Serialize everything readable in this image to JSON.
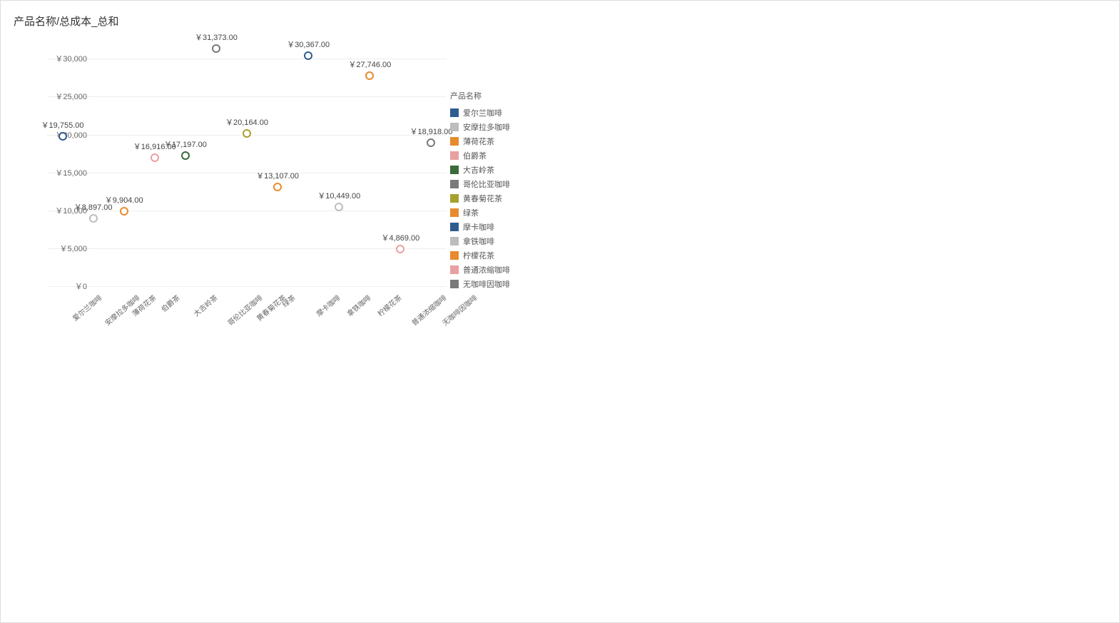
{
  "title": "产品名称/总成本_总和",
  "chart_data": {
    "type": "scatter",
    "title": "产品名称/总成本_总和",
    "xlabel": "",
    "ylabel": "",
    "ylim": [
      0,
      32000
    ],
    "categories": [
      "爱尔兰咖啡",
      "安摩拉多咖啡",
      "薄荷花茶",
      "伯爵茶",
      "大吉岭茶",
      "哥伦比亚咖啡",
      "黄春菊花茶",
      "绿茶",
      "摩卡咖啡",
      "拿铁咖啡",
      "柠檬花茶",
      "普通浓缩咖啡",
      "无咖啡因咖啡"
    ],
    "series": [
      {
        "name": "爱尔兰咖啡",
        "color": "#2F5B8F",
        "values": [
          {
            "x": "爱尔兰咖啡",
            "y": 19755,
            "label": "￥19,755.00"
          }
        ]
      },
      {
        "name": "安摩拉多咖啡",
        "color": "#BDBDBD",
        "values": [
          {
            "x": "安摩拉多咖啡",
            "y": 8897,
            "label": "￥8,897.00"
          }
        ]
      },
      {
        "name": "薄荷花茶",
        "color": "#E88B2D",
        "values": [
          {
            "x": "薄荷花茶",
            "y": 9904,
            "label": "￥9,904.00"
          }
        ]
      },
      {
        "name": "伯爵茶",
        "color": "#E8A0A0",
        "values": [
          {
            "x": "伯爵茶",
            "y": 16916,
            "label": "￥16,916.00"
          }
        ]
      },
      {
        "name": "大吉岭茶",
        "color": "#3B6B3B",
        "values": [
          {
            "x": "大吉岭茶",
            "y": 17197,
            "label": "￥17,197.00"
          }
        ]
      },
      {
        "name": "哥伦比亚咖啡",
        "color": "#7A7A7A",
        "values": [
          {
            "x": "哥伦比亚咖啡",
            "y": 31373,
            "label": "￥31,373.00"
          }
        ]
      },
      {
        "name": "黄春菊花茶",
        "color": "#A8A02E",
        "values": [
          {
            "x": "黄春菊花茶",
            "y": 20164,
            "label": "￥20,164.00"
          }
        ]
      },
      {
        "name": "绿茶",
        "color": "#E88B2D",
        "values": [
          {
            "x": "绿茶",
            "y": 13107,
            "label": "￥13,107.00"
          }
        ]
      },
      {
        "name": "摩卡咖啡",
        "color": "#2F5B8F",
        "values": [
          {
            "x": "摩卡咖啡",
            "y": 30367,
            "label": "￥30,367.00"
          }
        ]
      },
      {
        "name": "拿铁咖啡",
        "color": "#BDBDBD",
        "values": [
          {
            "x": "拿铁咖啡",
            "y": 10449,
            "label": "￥10,449.00"
          }
        ]
      },
      {
        "name": "柠檬花茶",
        "color": "#E88B2D",
        "values": [
          {
            "x": "柠檬花茶",
            "y": 27746,
            "label": "￥27,746.00"
          }
        ]
      },
      {
        "name": "普通浓缩咖啡",
        "color": "#E8A0A0",
        "values": [
          {
            "x": "普通浓缩咖啡",
            "y": 4869,
            "label": "￥4,869.00"
          }
        ]
      },
      {
        "name": "无咖啡因咖啡",
        "color": "#7A7A7A",
        "values": [
          {
            "x": "无咖啡因咖啡",
            "y": 18918,
            "label": "￥18,918.00"
          }
        ]
      }
    ],
    "y_ticks": [
      {
        "value": 0,
        "label": "￥0"
      },
      {
        "value": 5000,
        "label": "￥5,000"
      },
      {
        "value": 10000,
        "label": "￥10,000"
      },
      {
        "value": 15000,
        "label": "￥15,000"
      },
      {
        "value": 20000,
        "label": "￥20,000"
      },
      {
        "value": 25000,
        "label": "￥25,000"
      },
      {
        "value": 30000,
        "label": "￥30,000"
      }
    ],
    "legend_title": "产品名称",
    "legend_items": [
      {
        "name": "爱尔兰咖啡",
        "color": "#2F5B8F"
      },
      {
        "name": "安摩拉多咖啡",
        "color": "#BDBDBD"
      },
      {
        "name": "薄荷花茶",
        "color": "#E88B2D"
      },
      {
        "name": "伯爵茶",
        "color": "#E8A0A0"
      },
      {
        "name": "大吉岭茶",
        "color": "#3B6B3B"
      },
      {
        "name": "哥伦比亚咖啡",
        "color": "#7A7A7A"
      },
      {
        "name": "黄春菊花茶",
        "color": "#A8A02E"
      },
      {
        "name": "绿茶",
        "color": "#E88B2D"
      },
      {
        "name": "摩卡咖啡",
        "color": "#2F5B8F"
      },
      {
        "name": "拿铁咖啡",
        "color": "#BDBDBD"
      },
      {
        "name": "柠檬花茶",
        "color": "#E88B2D"
      },
      {
        "name": "普通浓缩咖啡",
        "color": "#E8A0A0"
      },
      {
        "name": "无咖啡因咖啡",
        "color": "#7A7A7A"
      }
    ]
  }
}
